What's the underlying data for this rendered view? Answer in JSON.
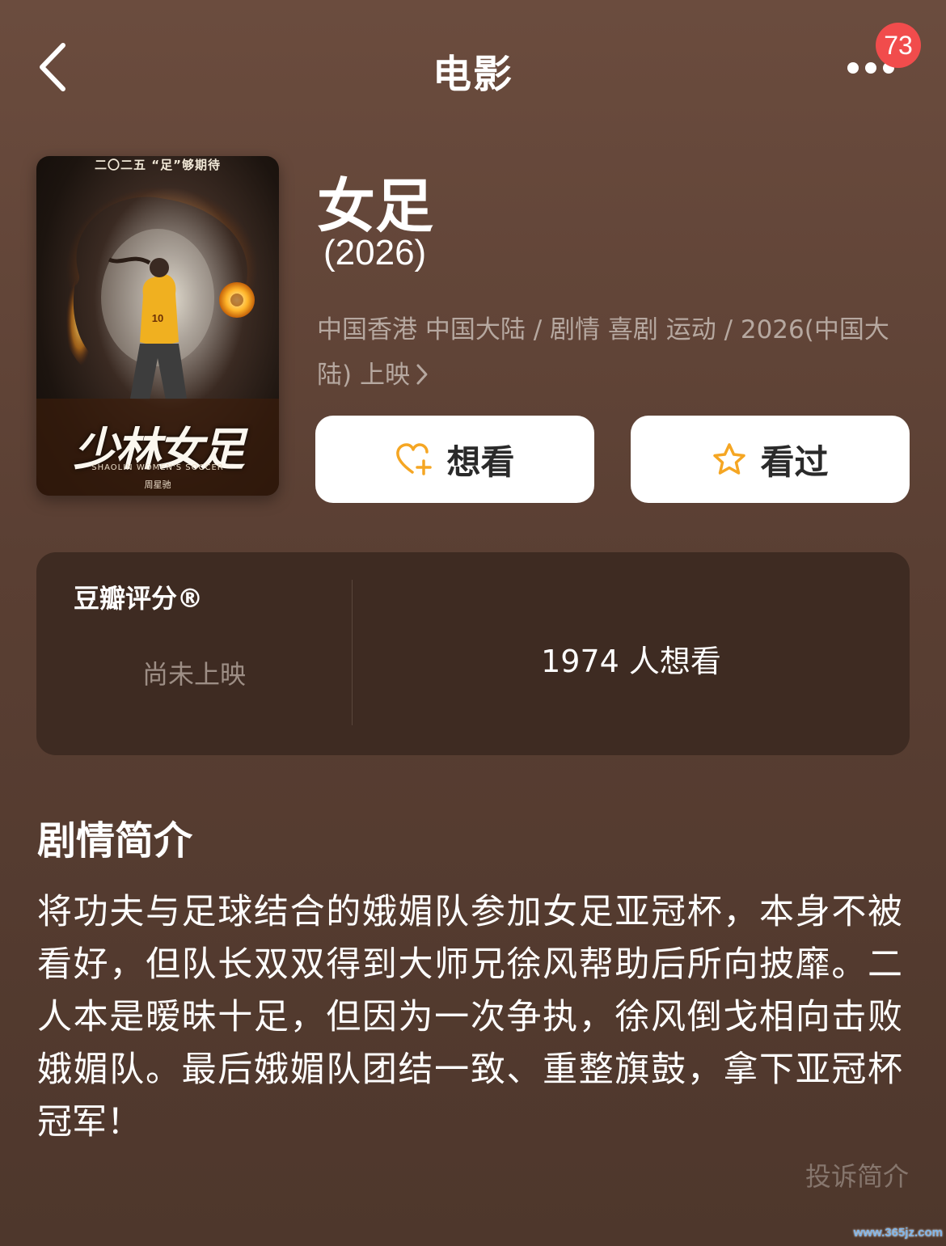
{
  "nav": {
    "title": "电影",
    "badge_count": "73"
  },
  "poster": {
    "top_text": "二〇二五 “足”够期待",
    "title_art": "少林女足",
    "subtitle_art": "SHAOLIN WOMEN'S SOCCER",
    "credit_art": "周星驰"
  },
  "movie": {
    "title": "女足",
    "year": "(2026)",
    "meta": "中国香港 中国大陆 / 剧情 喜剧 运动 / 2026(中国大陆) 上映"
  },
  "actions": {
    "want_label": "想看",
    "seen_label": "看过"
  },
  "rating": {
    "label": "豆瓣评分®",
    "status": "尚未上映",
    "want_count": "1974 人想看"
  },
  "synopsis": {
    "heading": "剧情简介",
    "text": "将功夫与足球结合的娥媚队参加女足亚冠杯，本身不被看好，但队长双双得到大师兄徐风帮助后所向披靡。二人本是暧昧十足，但因为一次争执，徐风倒戈相向击败娥媚队。最后娥媚队团结一致、重整旗鼓，拿下亚冠杯冠军！",
    "report_label": "投诉简介"
  },
  "watermark": "www.365jz.com",
  "colors": {
    "background": "#5a3f33",
    "card": "#3e2b22",
    "accent_icon": "#f5a623",
    "badge": "#f14c4c"
  },
  "icons": {
    "back": "chevron-left-icon",
    "more": "more-dots-icon",
    "want": "heart-plus-icon",
    "seen": "star-icon",
    "meta_arrow": "chevron-right-icon"
  }
}
